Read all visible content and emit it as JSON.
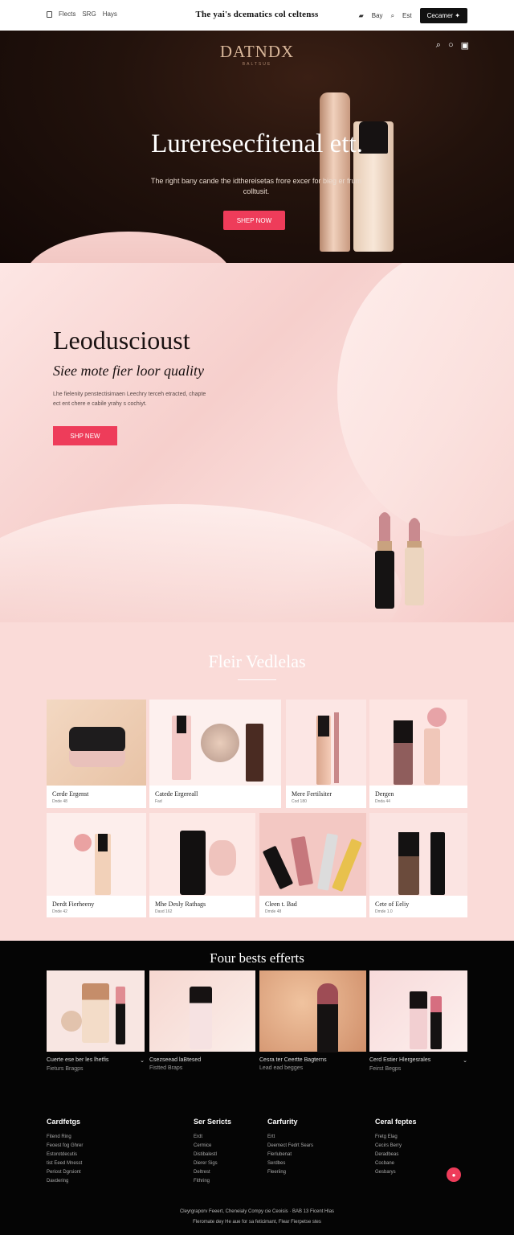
{
  "topbar": {
    "left_links": [
      "Flects",
      "SRG",
      "Hays"
    ],
    "center_title": "The yai's dcematics col celtenss",
    "right_links": [
      "Bay",
      "Est"
    ],
    "button_label": "Cecamer ✦"
  },
  "hero": {
    "brand": "DATNDX",
    "brand_sub": "BALTSUE",
    "headline": "Lureresecfitenal ett.",
    "subtext": "The right bany cande the idthereisetas frore excer for bieg er frum colltusit.",
    "cta": "SHEP NOW"
  },
  "feature": {
    "title": "Leoduscioust",
    "tagline": "Siee mote fier loor quality",
    "description": "Lhe fielenity penstectisimaen Leechry terceh etracted, chapte ect ent chere e cabile yrahy s cochiyt.",
    "cta": "SHP NEW"
  },
  "products": {
    "heading": "Fleir Vedlelas",
    "items": [
      {
        "name": "Cerde Ergenst",
        "price": "Dnde 48"
      },
      {
        "name": "Catede Ergereall",
        "price": "Fad"
      },
      {
        "name": "Mere Fertilsiter",
        "price": "Cod 180"
      },
      {
        "name": "Dergen",
        "price": "Dnda 44"
      },
      {
        "name": "Derdt Fierheeny",
        "price": "Dnde 42"
      },
      {
        "name": "Mhe Desly Rathags",
        "price": "Dasd 162"
      },
      {
        "name": "Cleen t. Bad",
        "price": "Dmde 48"
      },
      {
        "name": "Cete of Eeliy",
        "price": "Dmde 1.0"
      }
    ]
  },
  "best": {
    "heading": "Four bests efferts",
    "items": [
      {
        "title": "Cuerte ese ber les lhetfis",
        "sub": "Fieturs Bragps"
      },
      {
        "title": "Csezseead laBtesed",
        "sub": "Fistted Braps"
      },
      {
        "title": "Cesra ter Ceertte Bagterns",
        "sub": "Lead ead begges"
      },
      {
        "title": "Cerd Estier Hlergesrales",
        "sub": "Feirst Begps"
      }
    ]
  },
  "footer": {
    "columns": [
      {
        "title": "Cardfetgs",
        "links": [
          "Fitend Ring",
          "Feoest fog Ghrer",
          "Estorotdecutis",
          "tist Eeed Mnesst",
          "Periost Dgrsiont",
          "Davdering"
        ]
      },
      {
        "title": "Ser Sericts",
        "links": [
          "Erdt",
          "Cermice",
          "Distibalestl",
          "Dierer Sigs",
          "Deltrest",
          "Fithring"
        ]
      },
      {
        "title": "Carfurity",
        "links": [
          "Ertt",
          "Deemect Fedrt Sears",
          "Flerlubenat",
          "Serdbes",
          "Fleeriing"
        ]
      },
      {
        "title": "Ceral feptes",
        "links": [
          "Fretg Elag",
          "Cecirs Berry",
          "Deradbeas",
          "Cocbane",
          "Gesbarys"
        ]
      }
    ],
    "legal1": "Cleyrgraporv Feeert, Cheneialy Compy cie Ceoisis  ·  BAB 13 Ficent Hlas",
    "legal2": "Fleromate dey He aue for sa feticimant, Flear Fierpetse stes"
  }
}
